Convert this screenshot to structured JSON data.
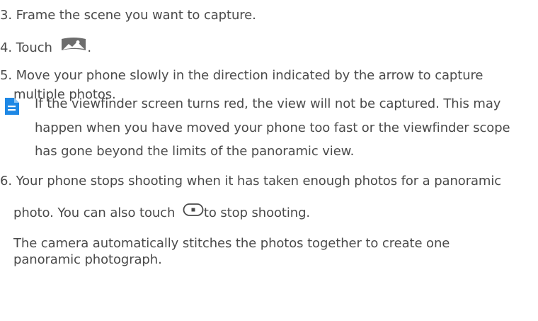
{
  "steps": {
    "step3": "3. Frame the scene you want to capture.",
    "step4_prefix": "4. Touch",
    "step4_suffix": ".",
    "step5_line1": "5. Move your phone slowly in the direction indicated by the arrow to capture",
    "step5_line2": "multiple photos.",
    "note_line1": "If the viewfinder screen turns red, the view will not be captured. This may",
    "note_line2": "happen when you have moved your phone too fast or the viewfinder scope",
    "note_line3": "has gone beyond the limits of the panoramic view.",
    "step6_line1": "6. Your phone stops shooting when it has taken enough photos for a panoramic",
    "step6_line2_prefix": "photo. You can also touch",
    "step6_line2_suffix": "to stop shooting.",
    "para_line1": "The camera automatically stitches the photos together to create one",
    "para_line2": "panoramic photograph."
  },
  "icons": {
    "panorama": "panorama-icon",
    "stop": "stop-shooting-icon",
    "note": "note-icon"
  },
  "colors": {
    "text": "#4a4a4a",
    "note_blue": "#1e88e5"
  }
}
